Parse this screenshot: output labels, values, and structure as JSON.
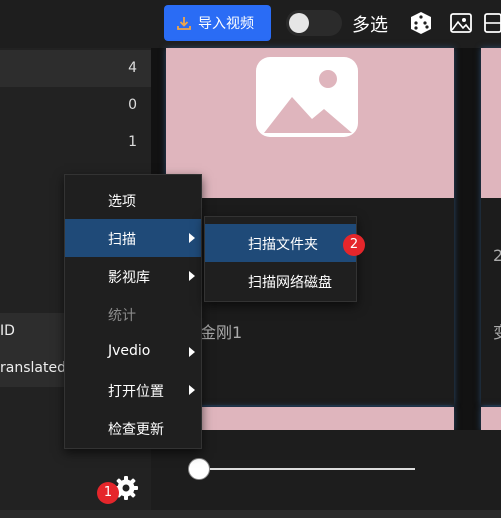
{
  "toolbar": {
    "import_label": "导入视频",
    "multi_select_label": "多选",
    "toggle_on": false
  },
  "sidebar": {
    "counts": [
      "4",
      "0",
      "1"
    ],
    "partial_labels": [
      "ID",
      "ranslated"
    ]
  },
  "context_menu": {
    "items": [
      {
        "label": "选项",
        "has_submenu": false,
        "state": "normal"
      },
      {
        "label": "扫描",
        "has_submenu": true,
        "state": "active"
      },
      {
        "label": "影视库",
        "has_submenu": true,
        "state": "normal"
      },
      {
        "label": "统计",
        "has_submenu": false,
        "state": "disabled"
      },
      {
        "label": "Jvedio",
        "has_submenu": true,
        "state": "normal"
      },
      {
        "label": "打开位置",
        "has_submenu": true,
        "state": "normal"
      },
      {
        "label": "检查更新",
        "has_submenu": false,
        "state": "normal"
      }
    ]
  },
  "submenu": {
    "items": [
      {
        "label": "扫描文件夹",
        "state": "active"
      },
      {
        "label": "扫描网络磁盘",
        "state": "normal"
      }
    ]
  },
  "cards": {
    "first_title": "形金刚1",
    "second_title_partial": "变",
    "second_partial_text": "2"
  },
  "badges": {
    "settings": "1",
    "scan_folder": "2"
  },
  "colors": {
    "accent": "#2a6cf5",
    "menu_active": "#1f4a78",
    "badge": "#e5262b",
    "thumb": "#dfb5bd"
  }
}
